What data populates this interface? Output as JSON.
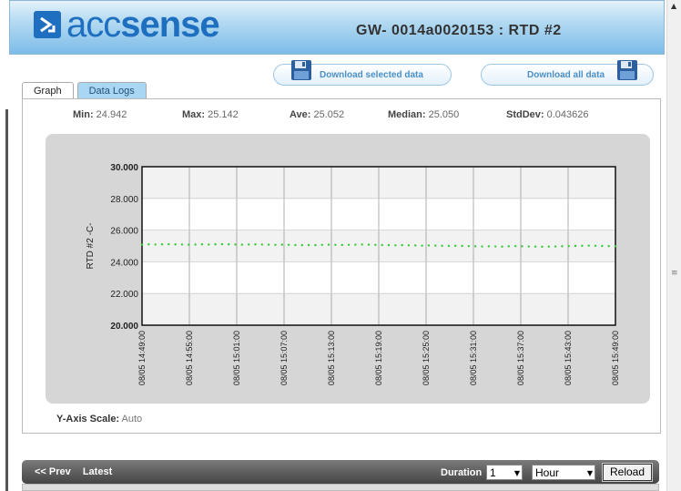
{
  "header": {
    "logo_prefix": "acc",
    "logo_suffix": "sense",
    "device_title": "GW- 0014a0020153 : RTD #2"
  },
  "actions": {
    "download_selected": "Download selected data",
    "download_all": "Download all data"
  },
  "tabs": [
    {
      "label": "Graph",
      "active": true
    },
    {
      "label": "Data Logs",
      "active": false
    }
  ],
  "stats": {
    "min_label": "Min:",
    "min_value": "24.942",
    "max_label": "Max:",
    "max_value": "25.142",
    "ave_label": "Ave:",
    "ave_value": "25.052",
    "median_label": "Median:",
    "median_value": "25.050",
    "stddev_label": "StdDev:",
    "stddev_value": "0.043626"
  },
  "y_axis_scale": {
    "label": "Y-Axis Scale:",
    "value": "Auto"
  },
  "footer": {
    "prev_label": "<< Prev",
    "latest_label": "Latest",
    "duration_label": "Duration",
    "duration_value": "1",
    "duration_unit": "Hour",
    "reload_label": "Reload"
  },
  "colors": {
    "accent": "#1f6fc0",
    "series": "#33cc33",
    "tab_inactive": "#a9d7f3"
  },
  "chart_data": {
    "type": "scatter",
    "ylabel": "RTD #2 -C-",
    "xlabel": "",
    "ylim": [
      20.0,
      30.0
    ],
    "yticks": [
      "20.000",
      "22.000",
      "24.000",
      "26.000",
      "28.000",
      "30.000"
    ],
    "xticks": [
      "08/05 14:49:00",
      "08/05 14:55:00",
      "08/05 15:01:00",
      "08/05 15:07:00",
      "08/05 15:13:00",
      "08/05 15:19:00",
      "08/05 15:25:00",
      "08/05 15:31:00",
      "08/05 15:37:00",
      "08/05 15:43:00",
      "08/05 15:49:00"
    ],
    "grid": true,
    "series": [
      {
        "values": [
          25.08,
          25.1,
          25.09,
          25.1,
          25.11,
          25.1,
          25.09,
          25.08,
          25.09,
          25.1,
          25.09,
          25.1,
          25.11,
          25.1,
          25.09,
          25.08,
          25.09,
          25.1,
          25.09,
          25.08,
          25.07,
          25.08,
          25.07,
          25.06,
          25.05,
          25.06,
          25.05,
          25.07,
          25.08,
          25.07,
          25.06,
          25.07,
          25.08,
          25.09,
          25.08,
          25.07,
          25.06,
          25.05,
          25.04,
          25.05,
          25.04,
          25.03,
          25.02,
          25.03,
          25.02,
          25.01,
          25.0,
          25.01,
          25.0,
          24.99,
          24.98,
          24.97,
          24.98,
          24.97,
          24.96,
          24.98,
          24.99,
          24.98,
          24.97,
          24.96,
          24.95,
          24.96,
          24.97,
          24.98,
          24.99,
          25.0,
          25.01,
          25.02,
          25.01,
          25.0,
          24.99,
          24.98
        ]
      }
    ]
  }
}
